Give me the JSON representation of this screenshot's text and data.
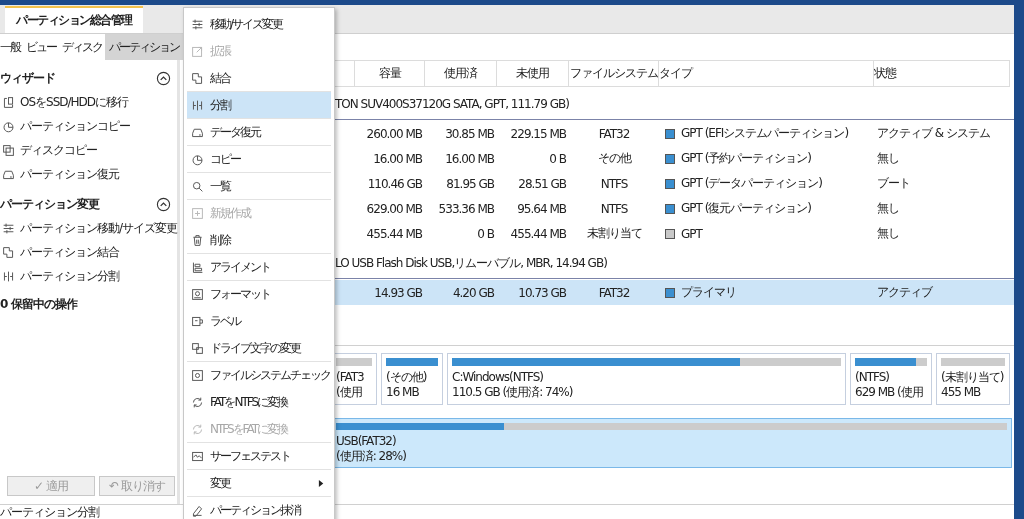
{
  "window": {
    "tab": "パーティション総合管理"
  },
  "ribbon_tabs": [
    {
      "label": "一般",
      "selected": false
    },
    {
      "label": "ビュー",
      "selected": false
    },
    {
      "label": "ディスク",
      "selected": false
    },
    {
      "label": "パーティション",
      "selected": true
    }
  ],
  "sidebar": {
    "sections": [
      {
        "title": "ウィザード",
        "expanded": true,
        "items": [
          "OSをSSD/HDDに移行",
          "パーティションコピー",
          "ディスクコピー",
          "パーティション復元"
        ]
      },
      {
        "title": "パーティション変更",
        "expanded": true,
        "items": [
          "パーティション移動/サイズ変更",
          "パーティション結合",
          "パーティション分割"
        ]
      }
    ],
    "pending": "0 保留中の操作",
    "buttons": [
      {
        "label": "適用",
        "icon": "✓",
        "disabled": true
      },
      {
        "label": "取り消す",
        "icon": "↶",
        "disabled": true
      }
    ]
  },
  "context_menu": [
    {
      "label": "移動/サイズ変更",
      "disabled": false,
      "selected": false,
      "divider": false,
      "submenu": false
    },
    {
      "label": "拡張",
      "disabled": true,
      "selected": false,
      "divider": false,
      "submenu": false
    },
    {
      "label": "結合",
      "disabled": false,
      "selected": false,
      "divider": true,
      "submenu": false
    },
    {
      "label": "分割",
      "disabled": false,
      "selected": true,
      "divider": true,
      "submenu": false
    },
    {
      "label": "データ復元",
      "disabled": false,
      "selected": false,
      "divider": true,
      "submenu": false
    },
    {
      "label": "コピー",
      "disabled": false,
      "selected": false,
      "divider": true,
      "submenu": false
    },
    {
      "label": "一覧",
      "disabled": false,
      "selected": false,
      "divider": true,
      "submenu": false
    },
    {
      "label": "新規作成",
      "disabled": true,
      "selected": false,
      "divider": false,
      "submenu": false
    },
    {
      "label": "削除",
      "disabled": false,
      "selected": false,
      "divider": true,
      "submenu": false
    },
    {
      "label": "アライメント",
      "disabled": false,
      "selected": false,
      "divider": true,
      "submenu": false
    },
    {
      "label": "フォーマット",
      "disabled": false,
      "selected": false,
      "divider": false,
      "submenu": false
    },
    {
      "label": "ラベル",
      "disabled": false,
      "selected": false,
      "divider": false,
      "submenu": false
    },
    {
      "label": "ドライブ文字の変更",
      "disabled": false,
      "selected": false,
      "divider": true,
      "submenu": false
    },
    {
      "label": "ファイルシステムチェック",
      "disabled": false,
      "selected": false,
      "divider": false,
      "submenu": false
    },
    {
      "label": "FATをNTFSに変換",
      "disabled": false,
      "selected": false,
      "divider": false,
      "submenu": false
    },
    {
      "label": "NTFSをFATに変換",
      "disabled": true,
      "selected": false,
      "divider": true,
      "submenu": false
    },
    {
      "label": "サーフェステスト",
      "disabled": false,
      "selected": false,
      "divider": true,
      "submenu": false
    },
    {
      "label": "変更",
      "disabled": false,
      "selected": false,
      "divider": true,
      "submenu": true
    },
    {
      "label": "パーティション抹消",
      "disabled": false,
      "selected": false,
      "submenu": false
    }
  ],
  "table": {
    "columns": [
      "容量",
      "使用済",
      "未使用",
      "ファイルシステム",
      "タイプ",
      "状態"
    ],
    "groups": [
      {
        "disk": "TON SUV400S37120G SATA, GPT, 111.79 GB)",
        "rows": [
          {
            "cells": [
              "260.00 MB",
              "30.85 MB",
              "229.15 MB",
              "FAT32"
            ],
            "type": "GPT (EFIシステムパーティション)",
            "color": "#3a8fd0",
            "status": "アクティブ & システム",
            "selected": false
          },
          {
            "cells": [
              "16.00 MB",
              "16.00 MB",
              "0 B",
              "その他"
            ],
            "type": "GPT (予約パーティション)",
            "color": "#3a8fd0",
            "status": "無し",
            "selected": false
          },
          {
            "cells": [
              "110.46 GB",
              "81.95 GB",
              "28.51 GB",
              "NTFS"
            ],
            "type": "GPT (データパーティション)",
            "color": "#3a8fd0",
            "status": "ブート",
            "selected": false
          },
          {
            "cells": [
              "629.00 MB",
              "533.36 MB",
              "95.64 MB",
              "NTFS"
            ],
            "type": "GPT (復元パーティション)",
            "color": "#3a8fd0",
            "status": "無し",
            "selected": false
          },
          {
            "cells": [
              "455.44 MB",
              "0 B",
              "455.44 MB",
              "未割り当て"
            ],
            "type": "GPT",
            "color": "#c8c8c8",
            "status": "無し",
            "selected": false
          }
        ]
      },
      {
        "disk": "LO USB Flash Disk USB,リムーバブル, MBR, 14.94 GB)",
        "rows": [
          {
            "cells": [
              "14.93 GB",
              "4.20 GB",
              "10.73 GB",
              "FAT32"
            ],
            "type": "プライマリ",
            "color": "#3a8fd0",
            "status": "アクティブ",
            "selected": true
          }
        ]
      }
    ]
  },
  "disk_map": [
    {
      "selected": false,
      "blocks": [
        {
          "name": "(FAT3",
          "info": "(使用",
          "level": 0
        },
        {
          "name": "(その他)",
          "info": "16 MB",
          "level": 1
        },
        {
          "name": "C:Windows(NTFS)",
          "info": "110.5 GB (使用済: 74%)",
          "level": 0.74
        },
        {
          "name": "(NTFS)",
          "info": "629 MB (使用",
          "level": 0.85
        },
        {
          "name": "(未割り当て)",
          "info": "455 MB",
          "level": 0
        }
      ]
    },
    {
      "selected": true,
      "blocks": [
        {
          "name": "USB(FAT32)",
          "info": "(使用済: 28%)",
          "level": 0.25
        }
      ]
    }
  ],
  "status_bar": "パーティション分割"
}
